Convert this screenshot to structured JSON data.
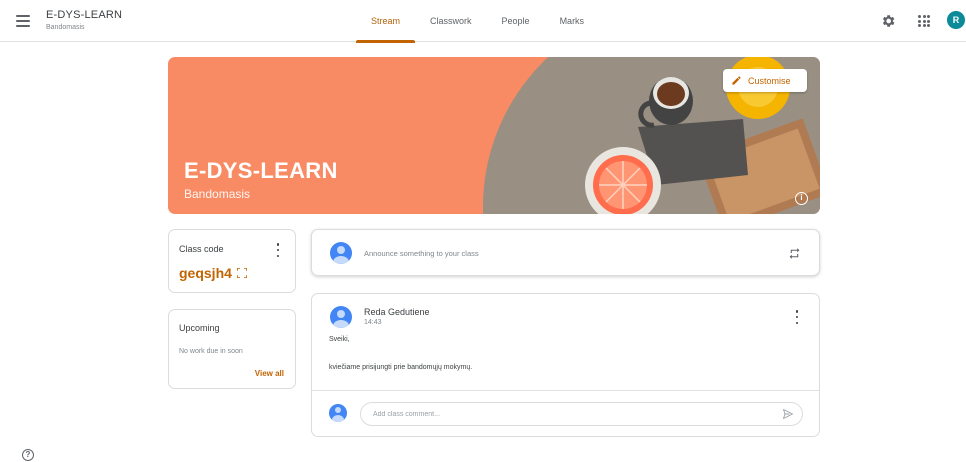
{
  "header": {
    "class_name": "E-DYS-LEARN",
    "section": "Bandomasis",
    "tabs": [
      {
        "label": "Stream",
        "active": true
      },
      {
        "label": "Classwork",
        "active": false
      },
      {
        "label": "People",
        "active": false
      },
      {
        "label": "Marks",
        "active": false
      }
    ],
    "avatar_initial": "R",
    "icons": [
      "menu-icon",
      "gear-icon",
      "apps-grid-icon"
    ]
  },
  "banner": {
    "title": "E-DYS-LEARN",
    "subtitle": "Bandomasis",
    "customise_label": "Customise",
    "info_glyph": "i",
    "color": "#f98b64"
  },
  "class_code": {
    "label": "Class code",
    "value": "geqsjh4"
  },
  "upcoming": {
    "title": "Upcoming",
    "empty_text": "No work due in soon",
    "view_all_label": "View all"
  },
  "announce": {
    "placeholder": "Announce something to your class"
  },
  "post": {
    "author": "Reda Gedutiene",
    "time": "14:43",
    "line1": "Sveiki,",
    "line2": "kviečiame prisijungti prie bandomųjų mokymų.",
    "comment_placeholder": "Add class comment..."
  },
  "help_glyph": "?",
  "accent_color": "#c26401"
}
